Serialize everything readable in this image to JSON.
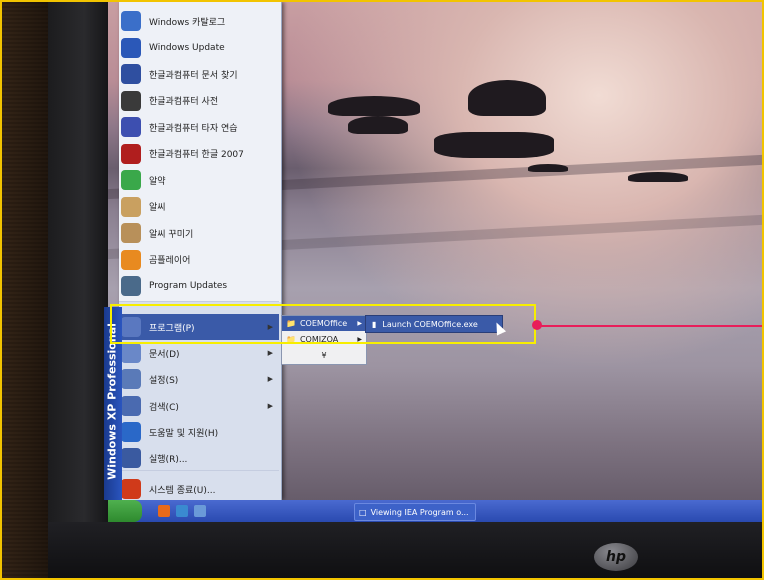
{
  "start_menu": {
    "pinned": [
      {
        "label": "Windows 카탈로그",
        "icon": "windows-catalog-icon",
        "color": "#3b6fc9"
      },
      {
        "label": "Windows Update",
        "icon": "windows-update-icon",
        "color": "#2b58b8"
      },
      {
        "label": "한글과컴퓨터 문서 찾기",
        "icon": "hancom-doc-find-icon",
        "color": "#2f4fa0"
      },
      {
        "label": "한글과컴퓨터 사전",
        "icon": "hancom-dictionary-icon",
        "color": "#3a3a3a"
      },
      {
        "label": "한글과컴퓨터 타자 연습",
        "icon": "hancom-typing-icon",
        "color": "#3d4fb0"
      },
      {
        "label": "한글과컴퓨터 한글 2007",
        "icon": "hangul-2007-icon",
        "color": "#b01e1e"
      },
      {
        "label": "알약",
        "icon": "alyac-icon",
        "color": "#3aa84a"
      },
      {
        "label": "알씨",
        "icon": "alsee-icon",
        "color": "#c9a060"
      },
      {
        "label": "알씨 꾸미기",
        "icon": "alsee-decorate-icon",
        "color": "#b8905a"
      },
      {
        "label": "곰플레이어",
        "icon": "gomplayer-icon",
        "color": "#e88a20"
      },
      {
        "label": "Program Updates",
        "icon": "program-updates-icon",
        "color": "#4a6a8a"
      }
    ],
    "lower": [
      {
        "label": "프로그램(P)",
        "icon": "programs-icon",
        "color": "#5a78c0",
        "arrow": true
      },
      {
        "label": "문서(D)",
        "icon": "documents-icon",
        "color": "#6a88c8",
        "arrow": true
      },
      {
        "label": "설정(S)",
        "icon": "settings-icon",
        "color": "#5a7ab8",
        "arrow": true
      },
      {
        "label": "검색(C)",
        "icon": "search-icon",
        "color": "#4a6ab0",
        "arrow": true
      },
      {
        "label": "도움말 및 지원(H)",
        "icon": "help-icon",
        "color": "#2a68c8",
        "arrow": false
      },
      {
        "label": "실행(R)...",
        "icon": "run-icon",
        "color": "#3a5aa0",
        "arrow": false
      },
      {
        "label": "시스템 종료(U)...",
        "icon": "shutdown-icon",
        "color": "#d03a1a",
        "arrow": false
      }
    ],
    "side_label": "Windows XP Professional"
  },
  "programs_submenu": [
    {
      "label": "COEMOffice",
      "icon": "folder-icon"
    },
    {
      "label": "COMIZOA",
      "icon": "folder-icon"
    },
    {
      "label": "¥",
      "icon": "expand-icon"
    }
  ],
  "coemoffice_submenu": {
    "label": "Launch COEMOffice.exe",
    "icon": "exe-icon"
  },
  "taskbar": {
    "task_label": "Viewing IEA Program o..."
  },
  "monitor_brand": "hp"
}
